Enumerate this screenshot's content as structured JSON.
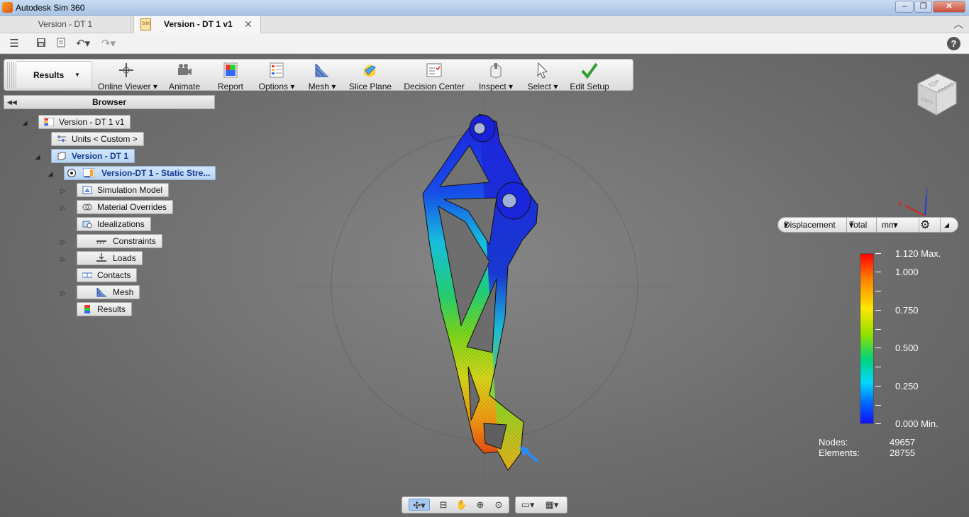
{
  "window": {
    "title": "Autodesk Sim 360",
    "controls": {
      "minimize": "–",
      "maximize": "❐",
      "close": "✕"
    }
  },
  "tabs": {
    "inactive_label": "Version - DT 1",
    "active_label": "Version - DT 1 v1",
    "active_icon_text": "SIM",
    "close": "✕"
  },
  "ribbon": {
    "workspace": "Results",
    "tools": [
      {
        "label": "Online Viewer",
        "has_menu": true,
        "icon": "online-viewer-icon"
      },
      {
        "label": "Animate",
        "has_menu": false,
        "icon": "animate-icon"
      },
      {
        "label": "Report",
        "has_menu": false,
        "icon": "report-icon"
      },
      {
        "label": "Options",
        "has_menu": true,
        "icon": "options-icon"
      },
      {
        "label": "Mesh",
        "has_menu": true,
        "icon": "mesh-icon"
      },
      {
        "label": "Slice Plane",
        "has_menu": false,
        "icon": "slice-plane-icon"
      },
      {
        "label": "Decision Center",
        "has_menu": false,
        "icon": "decision-center-icon"
      },
      {
        "label": "Inspect",
        "has_menu": true,
        "icon": "inspect-icon"
      },
      {
        "label": "Select",
        "has_menu": true,
        "icon": "select-icon"
      },
      {
        "label": "Edit Setup",
        "has_menu": false,
        "icon": "checkmark-icon"
      }
    ]
  },
  "browser": {
    "title": "Browser",
    "nodes": {
      "root": "Version - DT 1 v1",
      "units": "Units < Custom >",
      "design": "Version - DT 1",
      "study": "Version-DT 1 - Static Stre...",
      "simulation_model": "Simulation Model",
      "material_overrides": "Material Overrides",
      "idealizations": "Idealizations",
      "constraints": "Constraints",
      "loads": "Loads",
      "contacts": "Contacts",
      "mesh": "Mesh",
      "results": "Results"
    }
  },
  "view_cube": {
    "front": "FRONT",
    "top": "TOP",
    "left": "LEFT"
  },
  "triad": {
    "x": "X",
    "z": "Z"
  },
  "result_controls": {
    "type": "Displacement",
    "component": "Total",
    "unit": "mm"
  },
  "legend": {
    "max_label": "1.120 Max.",
    "labels": [
      "1.000",
      "0.750",
      "0.500",
      "0.250"
    ],
    "min_label": "0.000 Min.",
    "max_value": 1.12,
    "min_value": 0.0
  },
  "stats": {
    "nodes_label": "Nodes:",
    "nodes_value": "49657",
    "elements_label": "Elements:",
    "elements_value": "28755"
  },
  "colors": {
    "viewport": "#6e6e6e",
    "selection": "#b7d3f3",
    "result_low": "#1010ff",
    "result_high": "#ff0000"
  }
}
